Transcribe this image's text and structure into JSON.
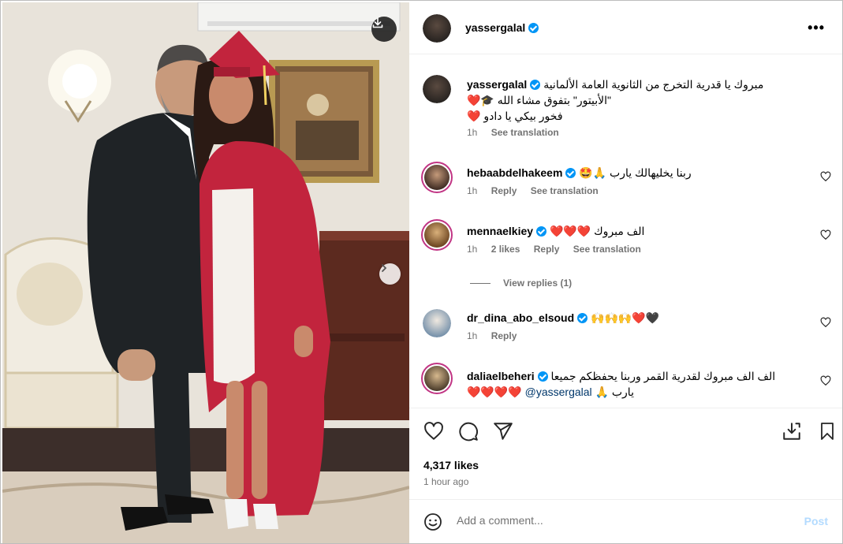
{
  "post": {
    "username": "yassergalal",
    "verified": true,
    "caption_lines": [
      "مبروك يا قدرية التخرج من الثانوية العامة الألمانية",
      "\"الأبيتور\" بتفوق مشاء الله 🎓❤️",
      "فخور بيكي يا دادو ❤️"
    ],
    "caption_time": "1h",
    "see_translation": "See translation"
  },
  "comments": [
    {
      "username": "hebaabdelhakeem",
      "verified": true,
      "text": "ربنا يخليهالك يارب 🙏🤩",
      "time": "1h",
      "reply": "Reply",
      "see_translation": "See translation"
    },
    {
      "username": "mennaelkiey",
      "verified": true,
      "text": "الف مبروك ❤️❤️❤️",
      "time": "1h",
      "likes": "2 likes",
      "reply": "Reply",
      "see_translation": "See translation",
      "view_replies": "View replies (1)"
    },
    {
      "username": "dr_dina_abo_elsoud",
      "verified": true,
      "text": "🙌🙌🙌❤️🖤",
      "time": "1h",
      "reply": "Reply"
    },
    {
      "username": "daliaelbeheri",
      "verified": true,
      "text_line1": "الف الف مبروك لقدرية القمر وربنا يحفظكم جميعا",
      "mention": "@yassergalal",
      "text_line2_suffix": "يارب 🙏",
      "hearts": "❤️❤️❤️❤️"
    }
  ],
  "actions": {
    "likes": "4,317 likes",
    "time_ago": "1 hour ago"
  },
  "composer": {
    "placeholder": "Add a comment...",
    "post_label": "Post"
  },
  "icons": [
    "download-icon",
    "chevron-right-icon",
    "more-icon",
    "heart-icon",
    "comment-icon",
    "share-icon",
    "save-to-collection-icon",
    "bookmark-icon",
    "emoji-icon",
    "verified-badge-icon"
  ],
  "colors": {
    "verified": "#0095f6",
    "link": "#00376b",
    "muted": "#737373",
    "post_disabled": "#b3dbff",
    "gown": "#c2243d"
  }
}
